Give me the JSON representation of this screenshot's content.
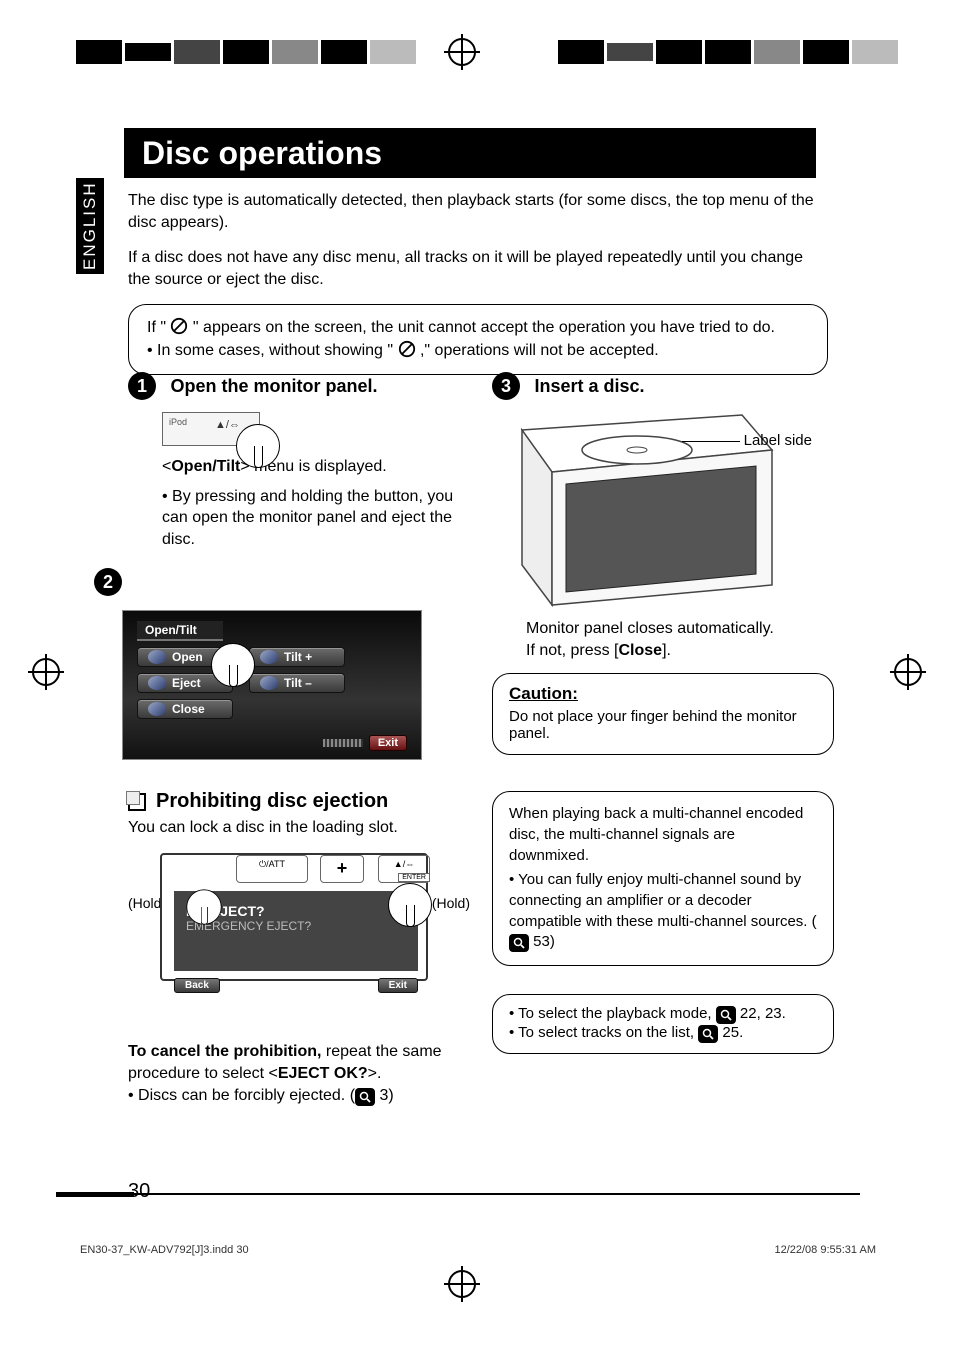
{
  "language_tab": "ENGLISH",
  "title": "Disc operations",
  "intro1": "The disc type is automatically detected, then playback starts (for some discs, the top menu of the disc appears).",
  "intro2": "If a disc does not have any disc menu, all tracks on it will be played repeatedly until you change the source or eject the disc.",
  "prohibit_note1_pre": "If \"",
  "prohibit_note1_post": "\" appears on the screen, the unit cannot accept the operation you have tried to do.",
  "prohibit_note2_pre": "•  In some cases, without showing \"",
  "prohibit_note2_post": ",\" operations will not be accepted.",
  "step1": {
    "num": "1",
    "title": "Open the monitor panel.",
    "ipod_label": "iPod",
    "eject_symbols": "▲/⇔",
    "menu_line_pre": "<",
    "menu_line_bold": "Open/Tilt",
    "menu_line_post": "> menu is displayed.",
    "bullet": "By pressing and holding the button, you can open the monitor panel and eject the disc."
  },
  "step2": {
    "num": "2",
    "menu_header": "Open/Tilt",
    "btn_open": "Open",
    "btn_eject": "Eject",
    "btn_close": "Close",
    "btn_tiltp": "Tilt +",
    "btn_tiltm": "Tilt –",
    "btn_exit": "Exit"
  },
  "section_prohibit": {
    "heading": "Prohibiting disc ejection",
    "lead": "You can lock a disc in the loading slot.",
    "hold": "(Hold)",
    "btn2_label": "+",
    "screen_main": "NO EJECT?",
    "screen_sub": "EMERGENCY EJECT?",
    "btn_back": "Back",
    "btn_exit": "Exit",
    "cancel_bold": "To cancel the prohibition,",
    "cancel_rest": " repeat the same procedure to select <",
    "cancel_opt": "EJECT OK?",
    "cancel_end": ">.",
    "forc_pre": "Discs can be forcibly ejected. (",
    "forc_page": " 3)"
  },
  "step3": {
    "num": "3",
    "title": "Insert a disc.",
    "label_side": "Label side",
    "closes": "Monitor panel closes automatically.",
    "ifnot_pre": "If not, press [",
    "ifnot_bold": "Close",
    "ifnot_post": "]."
  },
  "caution": {
    "label": "Caution:",
    "text": "Do not place your finger behind the monitor panel."
  },
  "mixbox": {
    "lead": "When playing back a multi-channel encoded disc, the multi-channel signals are downmixed.",
    "bullet_pre": "You can fully enjoy multi-channel sound by connecting an amplifier or a decoder compatible with these multi-channel sources. (",
    "bullet_page": " 53)"
  },
  "refs": {
    "row1_pre": "To select the playback mode, ",
    "row1_page": " 22, 23.",
    "row2_pre": "To select tracks on the list, ",
    "row2_page": " 25."
  },
  "page_number": "30",
  "jobline_left": "EN30-37_KW-ADV792[J]3.indd   30",
  "jobline_right": "12/22/08   9:55:31 AM",
  "icons": {
    "prohibit": "prohibit-icon",
    "magnifier": "magnifier-icon",
    "enter": "ENTER",
    "phi_att": "⏻/ATT",
    "eject_sym": "▲/⇔"
  }
}
